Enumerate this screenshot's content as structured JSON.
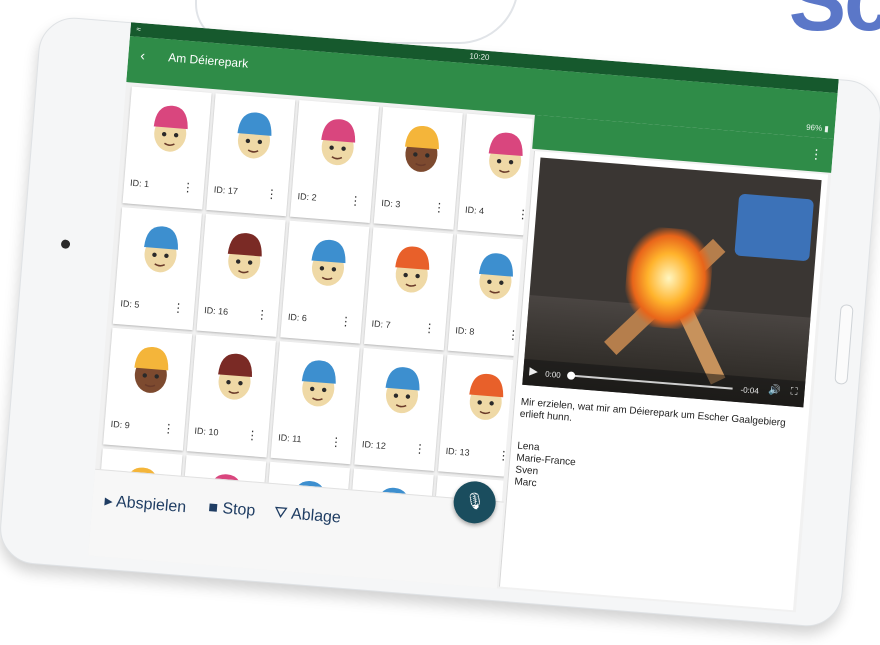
{
  "status": {
    "time": "10:20",
    "battery": "96%"
  },
  "app": {
    "title": "Am Déierepark"
  },
  "cards": [
    {
      "id": "ID: 1",
      "hair": "pink"
    },
    {
      "id": "ID: 17",
      "hair": "blue"
    },
    {
      "id": "ID: 2",
      "hair": "pink"
    },
    {
      "id": "ID: 3",
      "hair": "yellow"
    },
    {
      "id": "ID: 4",
      "hair": "pink"
    },
    {
      "id": "ID: 5",
      "hair": "blue"
    },
    {
      "id": "ID: 16",
      "hair": "brown"
    },
    {
      "id": "ID: 6",
      "hair": "blue"
    },
    {
      "id": "ID: 7",
      "hair": "orange"
    },
    {
      "id": "ID: 8",
      "hair": "blue"
    },
    {
      "id": "ID: 9",
      "hair": "yellow"
    },
    {
      "id": "ID: 10",
      "hair": "brown"
    },
    {
      "id": "ID: 11",
      "hair": "blue"
    },
    {
      "id": "ID: 12",
      "hair": "blue"
    },
    {
      "id": "ID: 13",
      "hair": "orange"
    },
    {
      "id": "",
      "hair": "yellow"
    },
    {
      "id": "",
      "hair": "pink"
    },
    {
      "id": "",
      "hair": "blue"
    },
    {
      "id": "",
      "hair": "blue"
    },
    {
      "id": "",
      "hair": "yellow"
    }
  ],
  "controls": {
    "play": "Abspielen",
    "stop": "Stop",
    "store": "Ablage"
  },
  "video": {
    "time_current": "0:00",
    "time_remaining": "-0:04"
  },
  "description": "Mir erzielen, wat mir am Déierepark um Escher Gaalgebierg erlieft hunn.",
  "names": [
    "Lena",
    "Marie-France",
    "Sven",
    "Marc"
  ],
  "colors": {
    "appbar": "#2f8c48",
    "statusbar": "#16592d",
    "fab": "#1a4d5e",
    "hair": {
      "pink": "#d9467e",
      "blue": "#3d8fcf",
      "yellow": "#f4b53a",
      "brown": "#7a2a25",
      "orange": "#e8602a"
    },
    "skin_light": "#efd9a6",
    "skin_dark": "#7d4a2f"
  }
}
